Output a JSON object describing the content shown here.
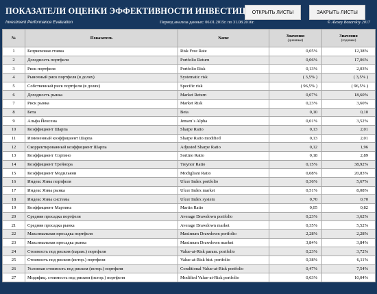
{
  "header": {
    "title": "ПОКАЗАТЕЛИ ОЦЕНКИ ЭФФЕКТИВНОСТИ ИНВЕСТИЦИЙ",
    "subtitle": "Investment Performance Evaluation",
    "period": "Период анализа данных: 06.01.2015г. по 31.08.2016г.",
    "copyright": "© Alexey Bozarskiy 2017",
    "open_button": "ОТКРЫТЬ ЛИСТЫ",
    "close_button": "ЗАКРЫТЬ ЛИСТЫ"
  },
  "table": {
    "col_no": "№",
    "col_indicator": "Показатель",
    "col_name": "Name",
    "col_daily": "Значения",
    "col_daily_unit": "(дневные)",
    "col_annual": "Значения",
    "col_annual_unit": "(годовые)",
    "rows": [
      {
        "no": "1",
        "ru": "Безрисковая ставка",
        "en": "Risk Free Rate",
        "daily": "0,05%",
        "annual": "12,38%"
      },
      {
        "no": "2",
        "ru": "Доходность портфеля",
        "en": "Portfolio Return",
        "daily": "0,06%",
        "annual": "17,06%"
      },
      {
        "no": "3",
        "ru": "Риск портфеля",
        "en": "Portfolio Risk",
        "daily": "0,13%",
        "annual": "2,03%"
      },
      {
        "no": "4",
        "ru": "Рыночный риск портфеля (в долях)",
        "en": "Systematic risk",
        "daily": "( 3,5% )",
        "annual": "( 3,5% )"
      },
      {
        "no": "5",
        "ru": "Собственный риск портфеля (в долях)",
        "en": "Specific risk",
        "daily": "( 96,5% )",
        "annual": "( 96,5% )"
      },
      {
        "no": "6",
        "ru": "Доходность рынка",
        "en": "Market Return",
        "daily": "0,07%",
        "annual": "18,60%"
      },
      {
        "no": "7",
        "ru": "Риск рынка",
        "en": "Market Risk",
        "daily": "0,23%",
        "annual": "3,60%"
      },
      {
        "no": "8",
        "ru": "Бета",
        "en": "Beta",
        "daily": "0,10",
        "annual": "0,10"
      },
      {
        "no": "9",
        "ru": "Альфа Йенсена",
        "en": "Jensen`s Alpha",
        "daily": "0,01%",
        "annual": "3,52%"
      },
      {
        "no": "10",
        "ru": "Коэффициент Шарпа",
        "en": "Sharpe Ratio",
        "daily": "0,13",
        "annual": "2,01"
      },
      {
        "no": "11",
        "ru": "Измененный коэффициент Шарпа",
        "en": "Sharpe Ratio modified",
        "daily": "0,13",
        "annual": "2,01"
      },
      {
        "no": "12",
        "ru": "Скорректированный коэффициент Шарпа",
        "en": "Adjusted Sharpe Ratio",
        "daily": "0,12",
        "annual": "1,96"
      },
      {
        "no": "13",
        "ru": "Коэффициент Сортино",
        "en": "Sortino Ratio",
        "daily": "0,18",
        "annual": "2,89"
      },
      {
        "no": "14",
        "ru": "Коэффициент Трейнора",
        "en": "Treynor Ratio",
        "daily": "0,15%",
        "annual": "38,92%"
      },
      {
        "no": "15",
        "ru": "Коэффициент Модильяни",
        "en": "Modigliani Ratio",
        "daily": "0,08%",
        "annual": "20,83%"
      },
      {
        "no": "16",
        "ru": "Индекс Язвы портфеля",
        "en": "Ulcer Index portfolio",
        "daily": "0,36%",
        "annual": "5,67%"
      },
      {
        "no": "17",
        "ru": "Индекс Язвы рынка",
        "en": "Ulcer Index market",
        "daily": "0,51%",
        "annual": "8,08%"
      },
      {
        "no": "18",
        "ru": "Индекс Язвы системы",
        "en": "Ulcer Index system",
        "daily": "0,70",
        "annual": "0,70"
      },
      {
        "no": "19",
        "ru": "Коэффициент Мартина",
        "en": "Martin Ratio",
        "daily": "0,05",
        "annual": "0,82"
      },
      {
        "no": "20",
        "ru": "Средняя просадка портфеля",
        "en": "Average Drawdown portfolio",
        "daily": "0,23%",
        "annual": "3,62%"
      },
      {
        "no": "21",
        "ru": "Средняя просадка рынка",
        "en": "Average Drawdown market",
        "daily": "0,35%",
        "annual": "5,52%"
      },
      {
        "no": "22",
        "ru": "Максимальная просадка портфеля",
        "en": "Maximum Drawdown portfolio",
        "daily": "2,28%",
        "annual": "2,28%"
      },
      {
        "no": "23",
        "ru": "Максимальная просадка рынка",
        "en": "Maximum Drawdown market",
        "daily": "3,84%",
        "annual": "3,84%"
      },
      {
        "no": "24",
        "ru": "Стоимость под риском (парам.) портфеля",
        "en": "Value-at-Risk param. portfolio",
        "daily": "0,23%",
        "annual": "3,72%"
      },
      {
        "no": "25",
        "ru": "Стоимость под риском (истор.) портфеля",
        "en": "Value-at-Risk hist. portfolio",
        "daily": "0,38%",
        "annual": "6,11%"
      },
      {
        "no": "26",
        "ru": "Условная стоимость под риском (истор.) портфеля",
        "en": "Conditional Value-at-Risk portfolio",
        "daily": "0,47%",
        "annual": "7,54%"
      },
      {
        "no": "27",
        "ru": "Модифиц. стоимость под риском (истор.) портфеля",
        "en": "Modified Value-at-Risk portfolio",
        "daily": "0,63%",
        "annual": "10,04%"
      }
    ]
  }
}
